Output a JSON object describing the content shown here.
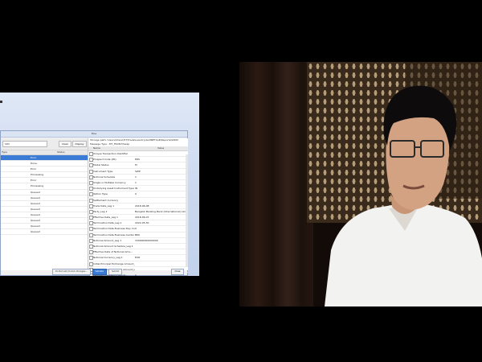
{
  "shared_screen": {
    "app_title": "Moa",
    "left_pane": {
      "search_value": "SWI",
      "toolbar_buttons": [
        "Clear",
        "Display"
      ],
      "columns": [
        "Type",
        "Status"
      ],
      "rows": [
        {
          "status": "Error",
          "selected": true
        },
        {
          "status": "Done",
          "selected": false
        },
        {
          "status": "Error",
          "selected": false
        },
        {
          "status": "Processing",
          "selected": false
        },
        {
          "status": "Error",
          "selected": false
        },
        {
          "status": "Processing",
          "selected": false
        },
        {
          "status": "Queued",
          "selected": false
        },
        {
          "status": "Queued",
          "selected": false
        },
        {
          "status": "Queued",
          "selected": false
        },
        {
          "status": "Queued",
          "selected": false
        },
        {
          "status": "Queued",
          "selected": false
        },
        {
          "status": "Queued",
          "selected": false
        },
        {
          "status": "Queued",
          "selected": false
        },
        {
          "status": "Queued",
          "selected": false
        }
      ]
    },
    "right_pane": {
      "path_label": "Storage path: \\Users\\Share\\TIT\\Trade\\Leandry\\ALMNETSAR\\Reports\\SWIM",
      "message_type_label": "Message Type : MT_FRONT/Swap",
      "columns": [
        "Name",
        "Value"
      ],
      "properties": [
        {
          "name": "Unique Transaction Identifier",
          "value": ""
        },
        {
          "name": "Prospect Code (PK)",
          "value": "ER5"
        },
        {
          "name": "Model Status",
          "value": "M"
        },
        {
          "name": "Instrument Type",
          "value": "SWP"
        },
        {
          "name": "Notional Schedule",
          "value": "1"
        },
        {
          "name": "Single or Multiple Currency",
          "value": "1"
        },
        {
          "name": "Underlying Asset Instrument Type",
          "value": "IN"
        },
        {
          "name": "Option Type",
          "value": "0"
        },
        {
          "name": "Settlement Currency",
          "value": ""
        },
        {
          "name": "Trade Date_Leg 1",
          "value": "2018-06-08"
        },
        {
          "name": "Party_Leg 1",
          "value": "Bangkok Banking Bank (International) Limited Ban..."
        },
        {
          "name": "Effective Date_Leg 1",
          "value": "2018-06-07"
        },
        {
          "name": "Termination Date_Leg 1",
          "value": "2022-05-30"
        },
        {
          "name": "Termination Date Business Day Co...",
          "value": "0"
        },
        {
          "name": "Termination Date Business Center Leg 1",
          "value": "BKK"
        },
        {
          "name": "Notional Amount_Leg 1",
          "value": "150000000000000"
        },
        {
          "name": "Notional Amount Schedule_Leg 1",
          "value": ""
        },
        {
          "name": "Effective Date of Notional Amo...",
          "value": ""
        },
        {
          "name": "Notional Currency_Leg 1",
          "value": "EUR"
        },
        {
          "name": "Initial Principal Exchange Amount_Leg 1",
          "value": ""
        },
        {
          "name": "Final Principal Exchange Amount_Leg 1",
          "value": ""
        },
        {
          "name": "Payment Frequency Period...",
          "value": "1"
        },
        {
          "name": "Payment Frequency Period_Leg 1",
          "value": "M"
        }
      ]
    },
    "bottom_buttons": [
      "Do Not List (Unlock Changes...",
      "Validate",
      "Submit"
    ],
    "close_button": "Close"
  },
  "colors": {
    "selection": "#3a7bd5",
    "desktop": "#cdd9ee",
    "wall_dark": "#3a2a1c",
    "shirt": "#f2f2f0"
  }
}
